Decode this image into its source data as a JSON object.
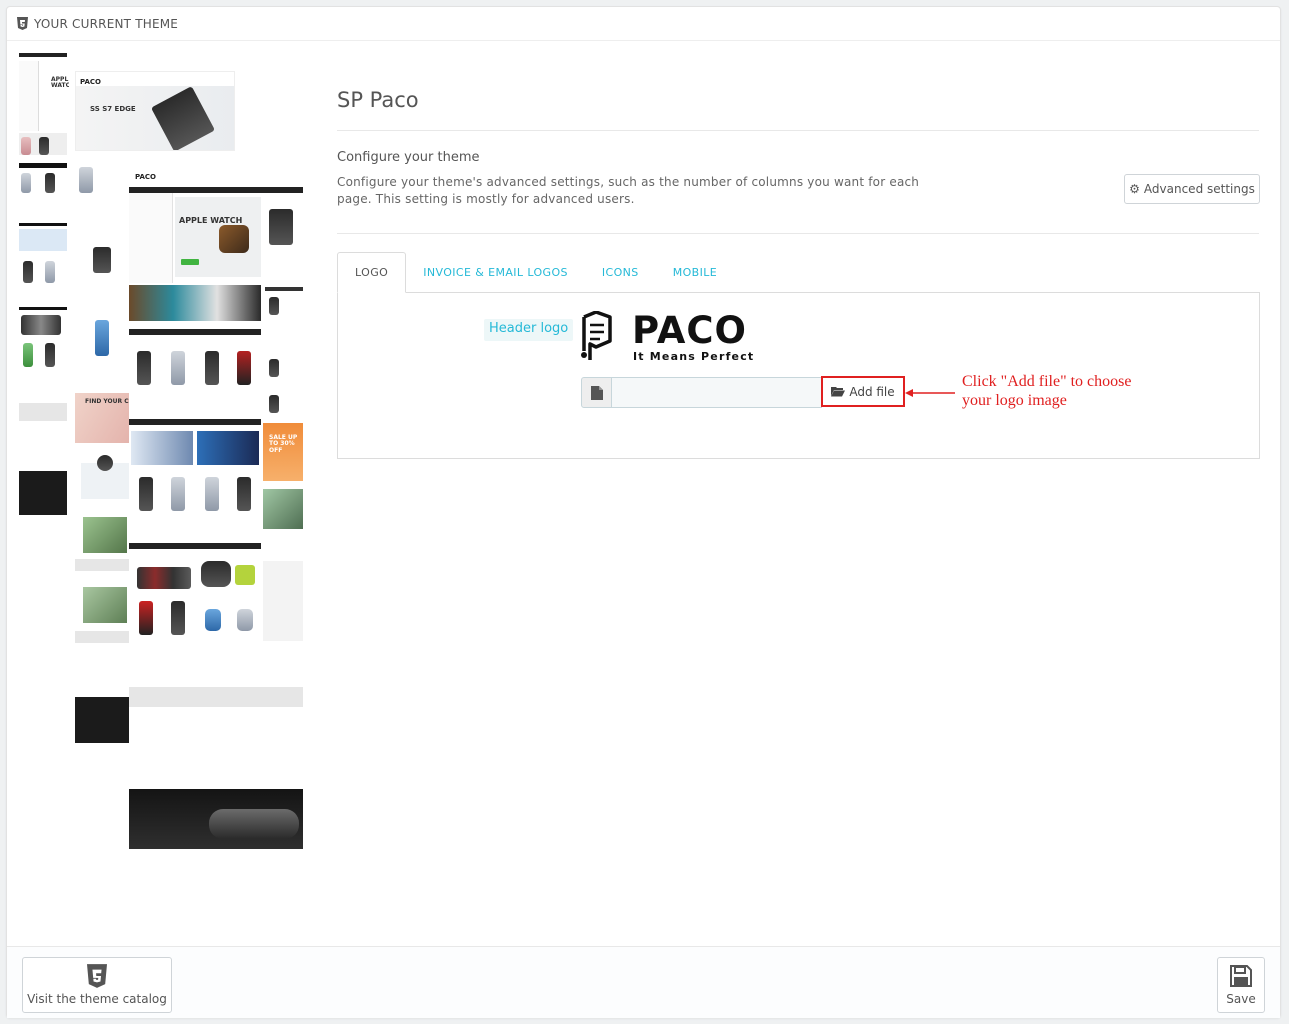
{
  "panel": {
    "heading": "YOUR CURRENT THEME"
  },
  "preview": {
    "brand": "PACO",
    "banner1": "SS S7 EDGE",
    "banner2": "APPLE WATCH",
    "banner3": "FIND YOUR CO",
    "promo": "SALE UP TO 30% OFF"
  },
  "theme": {
    "name": "SP Paco"
  },
  "configure": {
    "title": "Configure your theme",
    "description": "Configure your theme's advanced settings, such as the number of columns you want for each page. This setting is mostly for advanced users.",
    "advanced_button": "Advanced settings"
  },
  "tabs": [
    {
      "label": "LOGO",
      "active": true
    },
    {
      "label": "INVOICE & EMAIL LOGOS",
      "active": false
    },
    {
      "label": "ICONS",
      "active": false
    },
    {
      "label": "MOBILE",
      "active": false
    }
  ],
  "logo": {
    "label": "Header logo",
    "wordmark": "PACO",
    "tagline": "It Means Perfect",
    "add_file_button": "Add file"
  },
  "annotation": {
    "line1": "Click \"Add file\" to choose",
    "line2": "your logo image"
  },
  "footer": {
    "catalog_button": "Visit the theme catalog",
    "save_button": "Save"
  },
  "colors": {
    "accent": "#25b9d7",
    "annotation": "#e02020"
  }
}
